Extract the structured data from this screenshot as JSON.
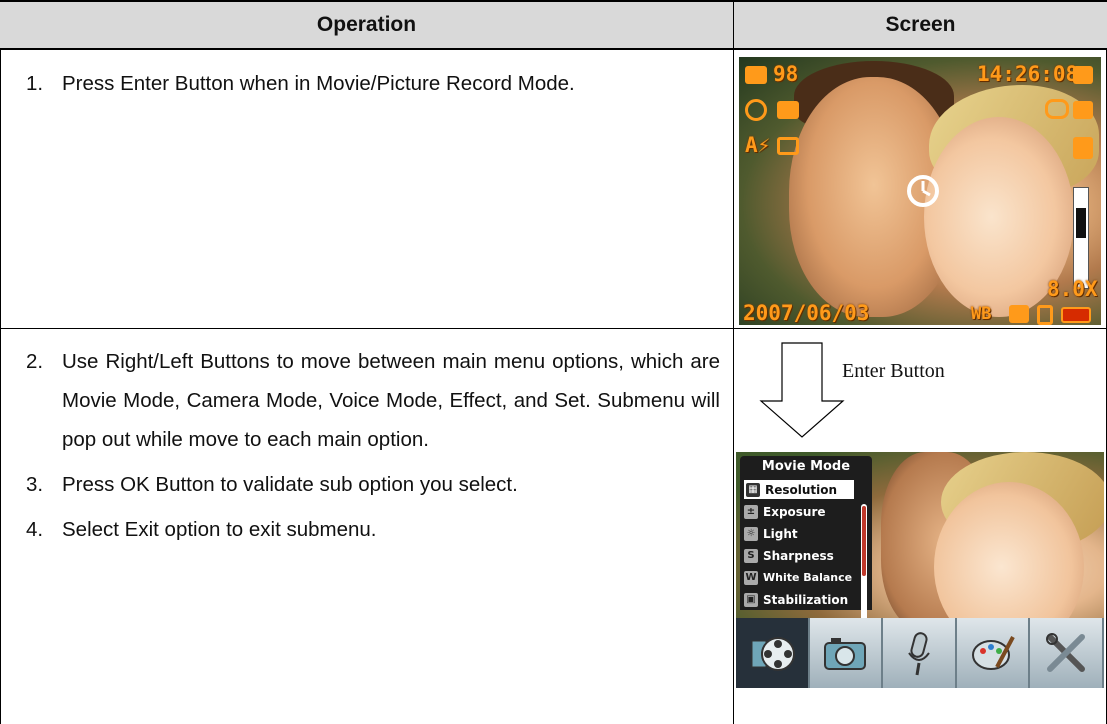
{
  "header": {
    "operation": "Operation",
    "screen": "Screen"
  },
  "steps_1": [
    {
      "num": "1.",
      "text": "Press Enter Button when in Movie/Picture Record Mode."
    }
  ],
  "steps_2": [
    {
      "num": "2.",
      "text": "Use Right/Left Buttons to move between main menu options, which are Movie Mode, Camera Mode, Voice Mode, Effect, and Set. Submenu will pop out while move to each main option."
    },
    {
      "num": "3.",
      "text": "Press OK Button to validate sub option you select."
    },
    {
      "num": "4.",
      "text": "Select Exit option to exit submenu."
    }
  ],
  "camera_screen": {
    "shots_remaining": "98",
    "time": "14:26:08",
    "zoom": "8.0X",
    "date": "2007/06/03",
    "wb_label": "WB",
    "osd_color": "#ff9a1a"
  },
  "arrow_caption": "Enter Button",
  "menu_screen": {
    "title": "Movie Mode",
    "items": [
      {
        "label": "Resolution",
        "icon": "resolution-icon",
        "selected": true
      },
      {
        "label": "Exposure",
        "icon": "exposure-icon",
        "selected": false
      },
      {
        "label": "Light",
        "icon": "light-icon",
        "selected": false
      },
      {
        "label": "Sharpness",
        "icon": "sharpness-icon",
        "selected": false
      },
      {
        "label": "White Balance",
        "icon": "white-balance-icon",
        "selected": false
      },
      {
        "label": "Stabilization",
        "icon": "stabilization-icon",
        "selected": false
      }
    ],
    "tabs": [
      "movie-reel-icon",
      "camera-icon",
      "microphone-icon",
      "palette-icon",
      "tools-icon"
    ]
  }
}
